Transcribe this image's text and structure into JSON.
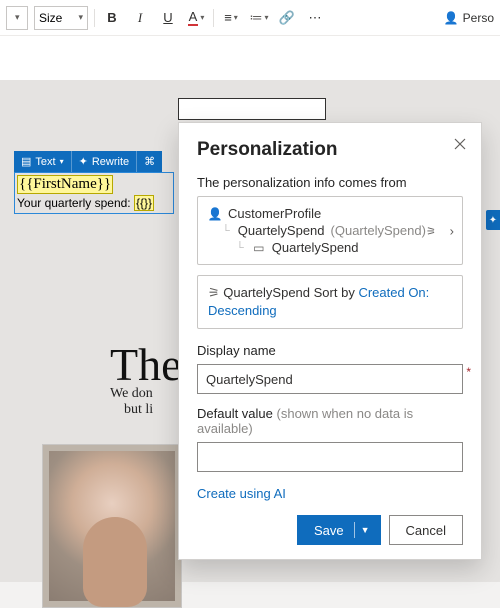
{
  "toolbar": {
    "size_label": "Size",
    "bold": "B",
    "italic": "I",
    "underline": "U",
    "font_color": "A",
    "more": "⋯",
    "perso_label": "Perso"
  },
  "context_bar": {
    "text_label": "Text",
    "rewrite_label": "Rewrite"
  },
  "selection": {
    "firstname_token": "{{FirstName}}",
    "line2_prefix": "Your quarterly spend: ",
    "line2_token": "{{}}"
  },
  "doc": {
    "headline": "The",
    "body1": "We don",
    "body2": "but li"
  },
  "panel": {
    "title": "Personalization",
    "source_label": "The personalization info comes from",
    "source": {
      "root": "CustomerProfile",
      "child": "QuartelySpend",
      "child_paren": "(QuartelySpend)",
      "leaf": "QuartelySpend"
    },
    "sort_prefix": "QuartelySpend",
    "sort_text": "Sort by",
    "sort_link": "Created On: Descending",
    "display_name_label": "Display name",
    "display_name_value": "QuartelySpend",
    "default_label": "Default value",
    "default_hint": "(shown when no data is available)",
    "default_value": "",
    "create_ai": "Create using AI",
    "save": "Save",
    "cancel": "Cancel"
  }
}
